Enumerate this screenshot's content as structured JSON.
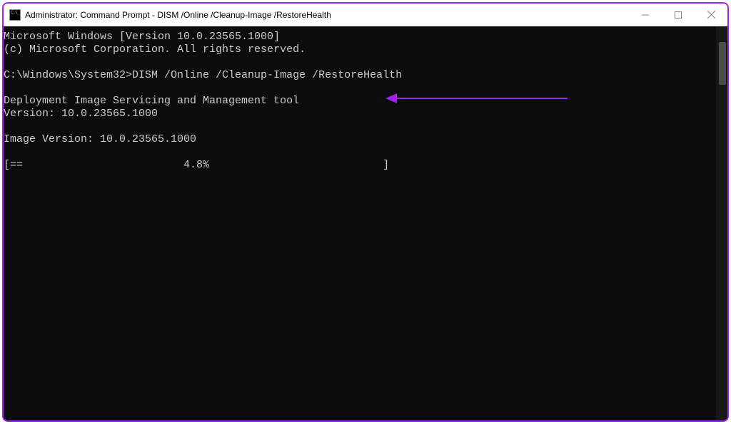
{
  "title": "Administrator: Command Prompt - DISM  /Online /Cleanup-Image /RestoreHealth",
  "terminal": {
    "line1": "Microsoft Windows [Version 10.0.23565.1000]",
    "line2": "(c) Microsoft Corporation. All rights reserved.",
    "blank1": "",
    "prompt": "C:\\Windows\\System32>DISM /Online /Cleanup-Image /RestoreHealth",
    "blank2": "",
    "tool1": "Deployment Image Servicing and Management tool",
    "tool2": "Version: 10.0.23565.1000",
    "blank3": "",
    "imgver": "Image Version: 10.0.23565.1000",
    "blank4": "",
    "progress": "[==                         4.8%                           ]"
  },
  "annotation": {
    "color": "#a020f0"
  }
}
